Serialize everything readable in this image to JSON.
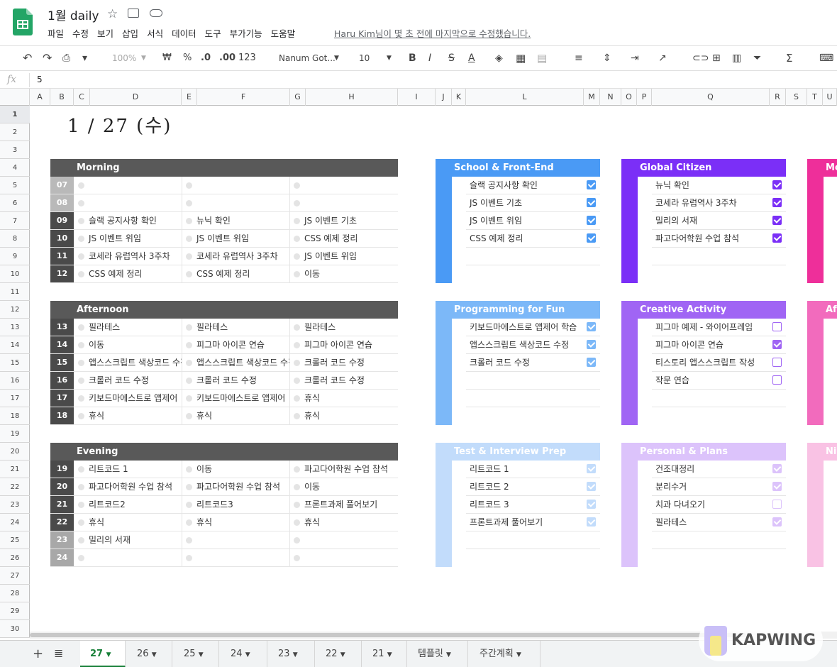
{
  "app": {
    "title": "1월 daily",
    "menu": [
      "파일",
      "수정",
      "보기",
      "삽입",
      "서식",
      "데이터",
      "도구",
      "부가기능",
      "도움말"
    ],
    "last_edit": "Haru Kim님이 몇 초 전에 마지막으로 수정했습니다."
  },
  "toolbar": {
    "zoom": "100%",
    "currency": "₩",
    "percent": "%",
    "dec_minus": ".0",
    "dec_plus": ".00",
    "format_more": "123",
    "font": "Nanum Got...",
    "size": "10",
    "bold": "B",
    "italic": "I",
    "strike": "S",
    "text_color": "A",
    "function": "Σ"
  },
  "formula": {
    "fx": "fx",
    "value": "5"
  },
  "columns": [
    "A",
    "B",
    "C",
    "D",
    "E",
    "F",
    "G",
    "H",
    "I",
    "J",
    "K",
    "L",
    "M",
    "N",
    "O",
    "P",
    "Q",
    "R",
    "S",
    "T",
    "U"
  ],
  "rows": [
    "1",
    "2",
    "3",
    "4",
    "5",
    "6",
    "7",
    "8",
    "9",
    "10",
    "11",
    "12",
    "13",
    "14",
    "15",
    "16",
    "17",
    "18",
    "19",
    "20",
    "21",
    "22",
    "23",
    "24",
    "25",
    "26",
    "27",
    "28",
    "29",
    "30"
  ],
  "date": "1 / 27 (수)",
  "schedule": [
    {
      "title": "Morning",
      "rows": [
        {
          "hour": "07",
          "cells": [
            "",
            "",
            ""
          ]
        },
        {
          "hour": "08",
          "cells": [
            "",
            "",
            ""
          ]
        },
        {
          "hour": "09",
          "cells": [
            "슬랙 공지사항 확인",
            "뉴닉 확인",
            "JS 이벤트 기초"
          ]
        },
        {
          "hour": "10",
          "cells": [
            "JS 이벤트 위임",
            "JS 이벤트 위임",
            "CSS 예제 정리"
          ]
        },
        {
          "hour": "11",
          "cells": [
            "코세라 유럽역사 3주차",
            "코세라 유럽역사 3주차",
            "JS 이벤트 위임"
          ]
        },
        {
          "hour": "12",
          "cells": [
            "CSS 예제 정리",
            "CSS 예제 정리",
            "이동"
          ]
        }
      ]
    },
    {
      "title": "Afternoon",
      "rows": [
        {
          "hour": "13",
          "cells": [
            "필라테스",
            "필라테스",
            "필라테스"
          ]
        },
        {
          "hour": "14",
          "cells": [
            "이동",
            "피그마 아이콘 연습",
            "피그마 아이콘 연습"
          ]
        },
        {
          "hour": "15",
          "cells": [
            "앱스스크립트 색상코드 수정",
            "앱스스크립트 색상코드 수정",
            "크롤러 코드 수정"
          ]
        },
        {
          "hour": "16",
          "cells": [
            "크롤러 코드 수정",
            "크롤러 코드 수정",
            "크롤러 코드 수정"
          ]
        },
        {
          "hour": "17",
          "cells": [
            "키보드마에스트로 앱제어",
            "키보드마에스트로 앱제어",
            "휴식"
          ]
        },
        {
          "hour": "18",
          "cells": [
            "휴식",
            "휴식",
            "휴식"
          ]
        }
      ]
    },
    {
      "title": "Evening",
      "rows": [
        {
          "hour": "19",
          "cells": [
            "리트코드 1",
            "이동",
            "파고다어학원 수업 참석"
          ]
        },
        {
          "hour": "20",
          "cells": [
            "파고다어학원 수업 참석",
            "파고다어학원 수업 참석",
            "이동"
          ]
        },
        {
          "hour": "21",
          "cells": [
            "리트코드2",
            "리트코드3",
            "프론트과제 풀어보기"
          ]
        },
        {
          "hour": "22",
          "cells": [
            "휴식",
            "휴식",
            "휴식"
          ]
        },
        {
          "hour": "23",
          "cells": [
            "밀리의 서재",
            "",
            ""
          ]
        },
        {
          "hour": "24",
          "cells": [
            "",
            "",
            ""
          ]
        }
      ]
    }
  ],
  "cards": [
    {
      "title": "School & Front-End",
      "color": "#4a9af5",
      "tasks": [
        {
          "label": "슬랙 공지사항 확인",
          "done": true
        },
        {
          "label": "JS 이벤트 기초",
          "done": true
        },
        {
          "label": "JS 이벤트 위임",
          "done": true
        },
        {
          "label": "CSS 예제 정리",
          "done": true
        }
      ]
    },
    {
      "title": "Global Citizen",
      "color": "#7b2ff7",
      "tasks": [
        {
          "label": "뉴닉 확인",
          "done": true
        },
        {
          "label": "코세라 유럽역사 3주차",
          "done": true
        },
        {
          "label": "밀리의 서재",
          "done": true
        },
        {
          "label": "파고다어학원 수업 참석",
          "done": true
        }
      ]
    },
    {
      "title": "Mo",
      "color": "#ee2f9a",
      "tasks": []
    },
    {
      "title": "Programming for Fun",
      "color": "#7cb8f8",
      "tasks": [
        {
          "label": "키보드마에스트로 앱제어 학습",
          "done": true
        },
        {
          "label": "앱스스크립트 색상코드 수정",
          "done": true
        },
        {
          "label": "크롤러 코드 수정",
          "done": true
        }
      ]
    },
    {
      "title": "Creative Activity",
      "color": "#a065f4",
      "tasks": [
        {
          "label": "피그마 예제 - 와이어프레임",
          "done": false
        },
        {
          "label": "피그마 아이콘 연습",
          "done": true
        },
        {
          "label": "티스토리 앱스스크립트 작성",
          "done": false
        },
        {
          "label": "작문 연습",
          "done": false
        }
      ]
    },
    {
      "title": "Af",
      "color": "#f26bbd",
      "tasks": []
    },
    {
      "title": "Test & Interview Prep",
      "color": "#c2dcfb",
      "tasks": [
        {
          "label": "리트코드 1",
          "done": true
        },
        {
          "label": "리트코드 2",
          "done": true
        },
        {
          "label": "리트코드 3",
          "done": true
        },
        {
          "label": "프론트과제 풀어보기",
          "done": true
        }
      ]
    },
    {
      "title": "Personal & Plans",
      "color": "#dcc3fb",
      "tasks": [
        {
          "label": "건조대정리",
          "done": true
        },
        {
          "label": "분리수거",
          "done": true
        },
        {
          "label": "치과 다녀오기",
          "done": false
        },
        {
          "label": "필라테스",
          "done": true
        }
      ]
    },
    {
      "title": "Ni",
      "color": "#f9c2e4",
      "tasks": []
    }
  ],
  "sheets": {
    "active": "27",
    "tabs": [
      "26",
      "25",
      "24",
      "23",
      "22",
      "21",
      "템플릿",
      "주간계획"
    ]
  },
  "watermark": "KAPWING"
}
